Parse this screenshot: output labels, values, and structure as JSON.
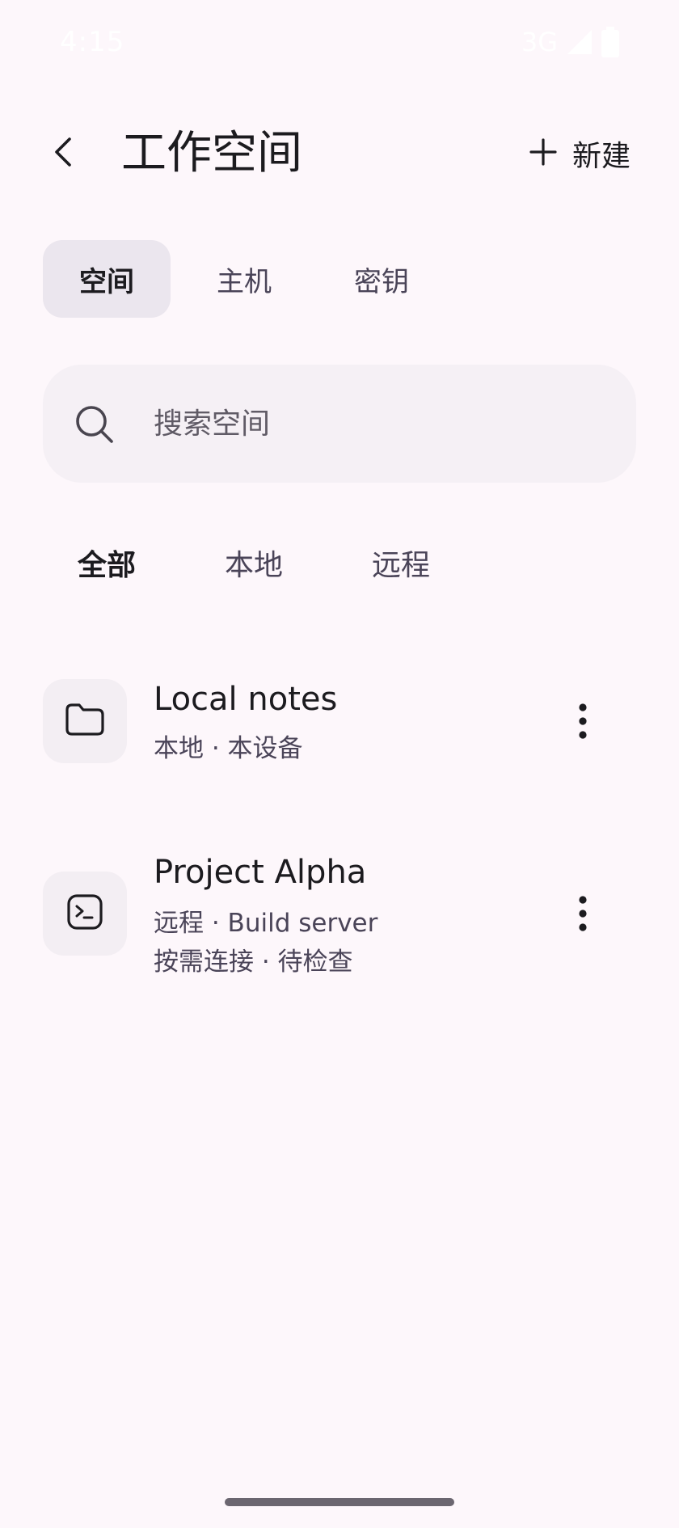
{
  "status_bar": {
    "time": "4:15",
    "network": "3G"
  },
  "header": {
    "title": "工作空间",
    "new_label": "新建"
  },
  "tabs": [
    {
      "label": "空间",
      "active": true
    },
    {
      "label": "主机",
      "active": false
    },
    {
      "label": "密钥",
      "active": false
    }
  ],
  "search": {
    "placeholder": "搜索空间",
    "value": ""
  },
  "filters": [
    {
      "label": "全部",
      "active": true
    },
    {
      "label": "本地",
      "active": false
    },
    {
      "label": "远程",
      "active": false
    }
  ],
  "workspaces": [
    {
      "icon": "folder-icon",
      "title": "Local notes",
      "subtitle": "本地 · 本设备",
      "detail": ""
    },
    {
      "icon": "terminal-icon",
      "title": "Project Alpha",
      "subtitle": "远程 · Build server",
      "detail": "按需连接 · 待检查"
    }
  ],
  "colors": {
    "background": "#fdf7fb",
    "active_tab": "#ebe6ee",
    "search_bg": "#f5f0f5",
    "text_primary": "#1c1b1f",
    "text_secondary": "#4a4458"
  }
}
